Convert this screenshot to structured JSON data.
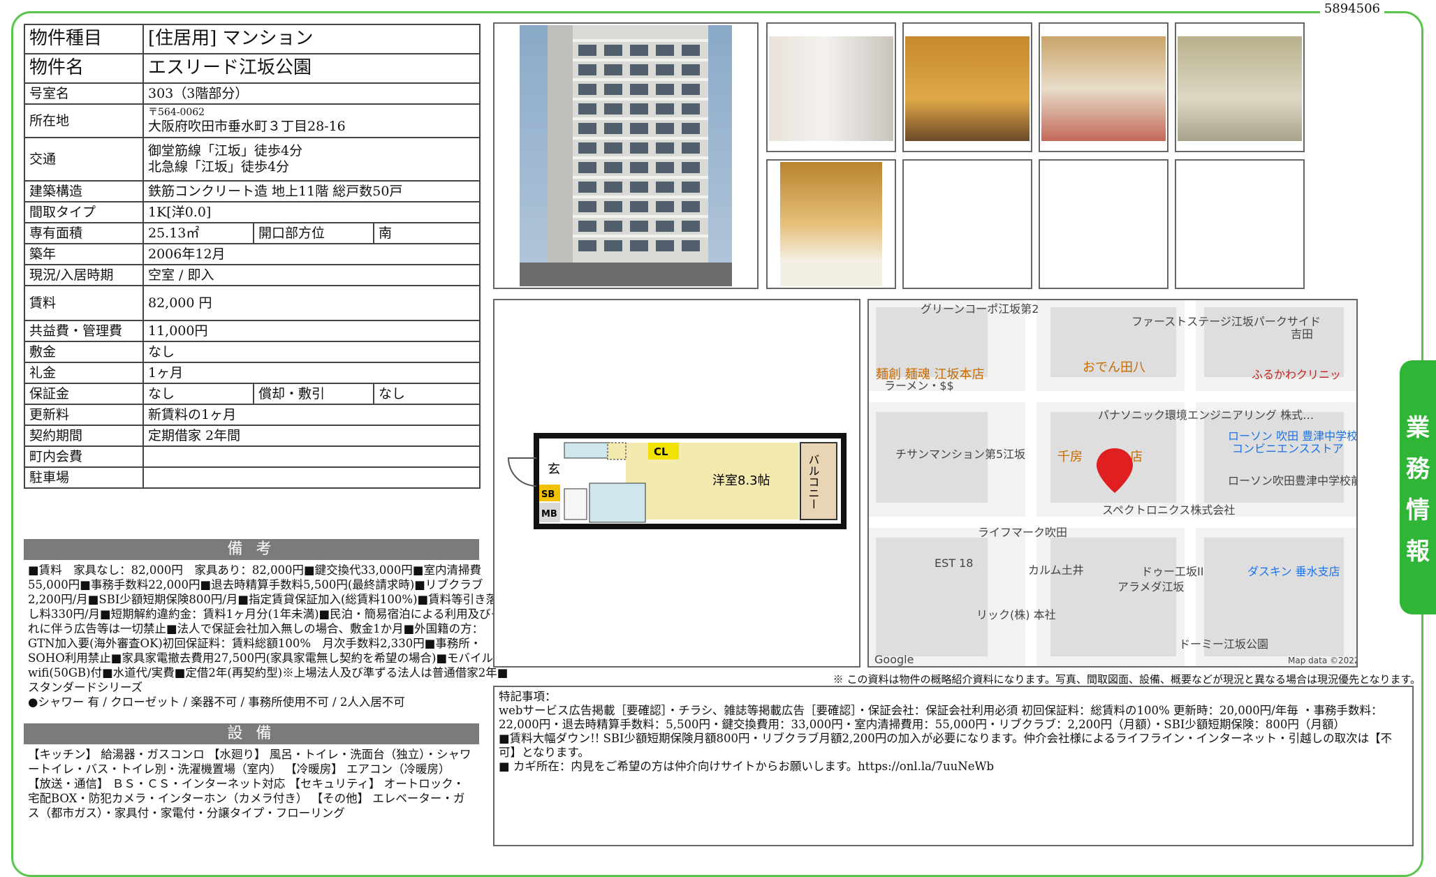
{
  "doc_id": "5894506",
  "side_tab": "業務情報",
  "spec": {
    "type_label": "物件種目",
    "type_value": "[住居用] マンション",
    "name_label": "物件名",
    "name_value": "エスリード江坂公園",
    "room_label": "号室名",
    "room_value": "303（3階部分）",
    "address_label": "所在地",
    "postal": "〒564-0062",
    "address_value": "大阪府吹田市垂水町３丁目28-16",
    "access_label": "交通",
    "access_1": "御堂筋線「江坂」徒歩4分",
    "access_2": "北急線「江坂」徒歩4分",
    "structure_label": "建築構造",
    "structure_value": "鉄筋コンクリート造 地上11階 総戸数50戸",
    "layout_label": "間取タイプ",
    "layout_value": "1K[洋0.0]",
    "area_label": "専有面積",
    "area_value": "25.13㎡",
    "direction_label": "開口部方位",
    "direction_value": "南",
    "built_label": "築年",
    "built_value": "2006年12月",
    "status_label": "現況/入居時期",
    "status_value": "空室 / 即入",
    "rent_label": "賃料",
    "rent_value": "82,000 円",
    "fee_label": "共益費・管理費",
    "fee_value": "11,000円",
    "deposit_label": "敷金",
    "deposit_value": "なし",
    "key_money_label": "礼金",
    "key_money_value": "1ヶ月",
    "guarantee_label": "保証金",
    "guarantee_value": "なし",
    "amort_label": "償却・敷引",
    "amort_value": "なし",
    "renewal_label": "更新料",
    "renewal_value": "新賃料の1ヶ月",
    "contract_label": "契約期間",
    "contract_value": "定期借家 2年間",
    "town_fee_label": "町内会費",
    "town_fee_value": "",
    "parking_label": "駐車場",
    "parking_value": ""
  },
  "remarks_head": "備 考",
  "remarks": "■賃料　家具なし：82,000円　家具あり：82,000円■鍵交換代33,000円■室内清掃費55,000円■事務手数料22,000円■退去時精算手数料5,500円(最終請求時)■リブクラブ2,200円/月■SBI少額短期保険800円/月■指定賃貸保証加入(総賃料100%)■賃料等引き落とし料330円/月■短期解約違約金：賃料1ヶ月分(1年未満)■民泊・簡易宿泊による利用及びそれに伴う広告等は一切禁止■法人で保証会社加入無しの場合、敷金1か月■外国籍の方：GTN加入要(海外審査OK)初回保証料：賃料総額100%　月次手数料2,330円■事務所・SOHO利用禁止■家具家電撤去費用27,500円(家具家電無し契約を希望の場合)■モバイルwifi(50GB)付■水道代/実費■定借2年(再契約型)※上場法人及び準ずる法人は普通借家2年■スタンダードシリーズ\n●シャワー 有 / クローゼット / 楽器不可 / 事務所使用不可 / 2人入居不可",
  "equip_head": "設 備",
  "equipment": "【キッチン】 給湯器・ガスコンロ 【水廻り】 風呂・トイレ・洗面台（独立）・シャワートイレ・バス・トイレ別・洗濯機置場（室内） 【冷暖房】 エアコン（冷暖房） 【放送・通信】 ＢＳ・ＣＳ・インターネット対応 【セキュリティ】 オートロック・宅配BOX・防犯カメラ・インターホン（カメラ付き） 【その他】 エレベーター・ガス（都市ガス）・家具付・家電付・分譲タイプ・フローリング",
  "floorplan": {
    "room_label": "洋室8.3帖",
    "balcony": "バルコニー",
    "entry": "玄",
    "closet": "CL",
    "sb": "SB",
    "mb": "MB"
  },
  "map": {
    "labels": [
      "グリーンコーポ江坂第2",
      "ファーストステージ江坂パークサイド",
      "吉田",
      "麺創 麺魂 江坂本店",
      "ラーメン・$$",
      "おでん田八",
      "ふるかわクリニッ",
      "パナソニック環境エンジニアリング 株式…",
      "ローソン 吹田 豊津中学校前店",
      "コンビニエンスストア",
      "チサンマンション第5江坂",
      "千房",
      "店",
      "ローソン吹田豊津中学校前店",
      "スペクトロニクス株式会社",
      "ライフマーク吹田",
      "EST 18",
      "カルム土井",
      "ドゥー工坂II",
      "アラメダ江坂",
      "ダスキン 垂水支店",
      "リック(株) 本社",
      "ドーミー江坂公園",
      "Google",
      "Map data ©2022"
    ]
  },
  "note": "※ この資料は物件の概略紹介資料になります。写真、間取図面、設備、概要などが現況と異なる場合は現況優先となります。",
  "special": "特記事項：\nwebサービス広告掲載［要確認］・チラシ、雑誌等掲載広告［要確認］・保証会社：保証会社利用必須 初回保証料：総賃料の100% 更新時：20,000円/年毎 ・事務手数料：22,000円・退去時精算手数料：5,500円・鍵交換費用：33,000円・室内清掃費用：55,000円・リブクラブ：2,200円（月額）・SBI少額短期保険：800円（月額）\n■賃料大幅ダウン!! SBI少額短期保険月額800円・リブクラブ月額2,200円の加入が必要になります。仲介会社様によるライフライン・インターネット・引越しの取次は【不可】となります。\n■ カギ所在：内見をご希望の方は仲介向けサイトからお願いします。https://onl.la/7uuNeWb"
}
